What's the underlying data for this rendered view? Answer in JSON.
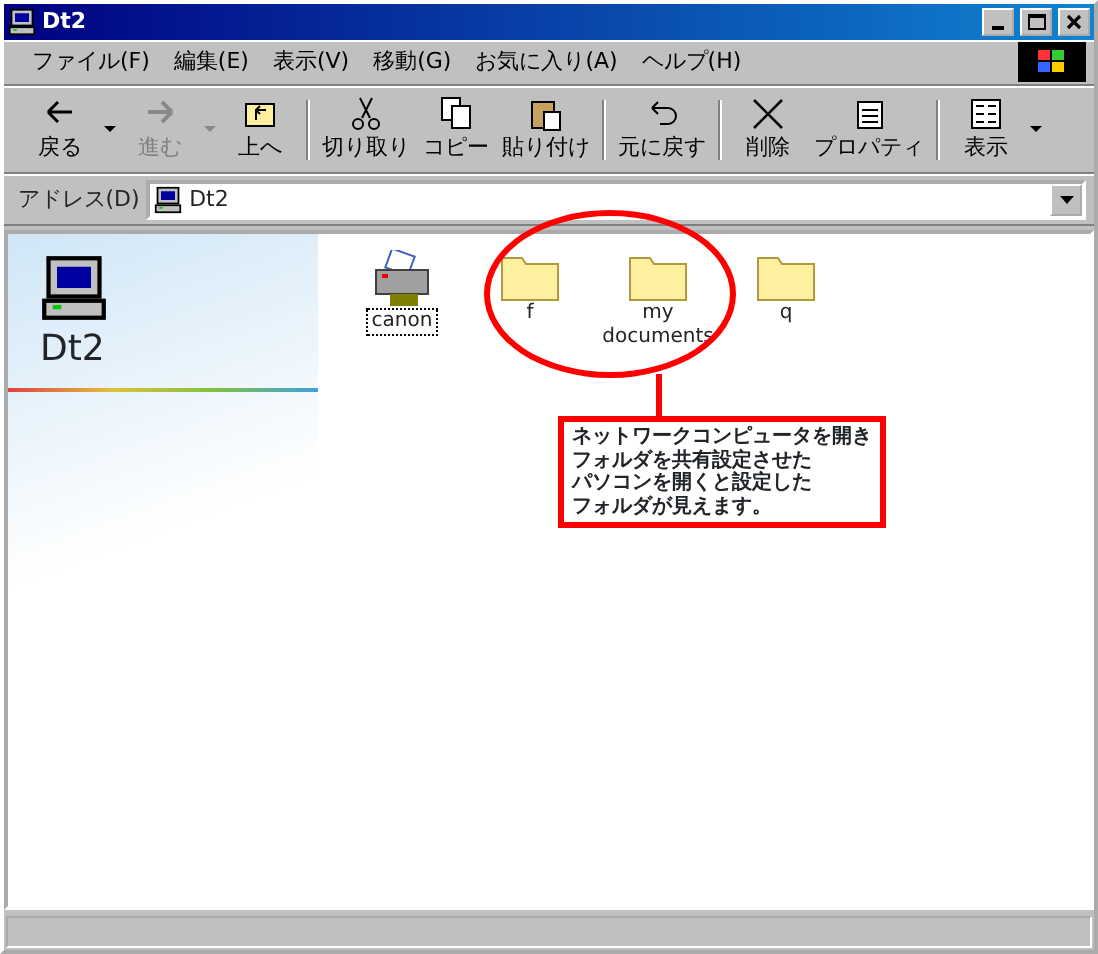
{
  "window": {
    "title": "Dt2"
  },
  "menu": [
    "ファイル(F)",
    "編集(E)",
    "表示(V)",
    "移動(G)",
    "お気に入り(A)",
    "ヘルプ(H)"
  ],
  "toolbar": [
    {
      "kind": "button",
      "label": "戻る",
      "dropdown": true,
      "disabled": false
    },
    {
      "kind": "button",
      "label": "進む",
      "dropdown": true,
      "disabled": true
    },
    {
      "kind": "button",
      "label": "上へ",
      "dropdown": false,
      "disabled": false
    },
    {
      "kind": "separator"
    },
    {
      "kind": "button",
      "label": "切り取り",
      "dropdown": false,
      "disabled": false
    },
    {
      "kind": "button",
      "label": "コピー",
      "dropdown": false,
      "disabled": false
    },
    {
      "kind": "button",
      "label": "貼り付け",
      "dropdown": false,
      "disabled": false
    },
    {
      "kind": "separator"
    },
    {
      "kind": "button",
      "label": "元に戻す",
      "dropdown": false,
      "disabled": false
    },
    {
      "kind": "separator"
    },
    {
      "kind": "button",
      "label": "削除",
      "dropdown": false,
      "disabled": false
    },
    {
      "kind": "button",
      "label": "プロパティ",
      "dropdown": false,
      "disabled": false
    },
    {
      "kind": "separator"
    },
    {
      "kind": "button",
      "label": "表示",
      "dropdown": true,
      "disabled": false
    }
  ],
  "address": {
    "label": "アドレス(D)",
    "value": "Dt2"
  },
  "panel": {
    "title": "Dt2"
  },
  "items": [
    {
      "kind": "printer",
      "name": "canon",
      "selected": true
    },
    {
      "kind": "folder",
      "name": "f",
      "selected": false
    },
    {
      "kind": "folder",
      "name": "my documents",
      "selected": false
    },
    {
      "kind": "folder",
      "name": "q",
      "selected": false
    }
  ],
  "callout": {
    "lines": [
      "ネットワークコンピュータを開き",
      "フォルダを共有設定させた",
      "パソコンを開くと設定した",
      "フォルダが見えます。"
    ]
  }
}
